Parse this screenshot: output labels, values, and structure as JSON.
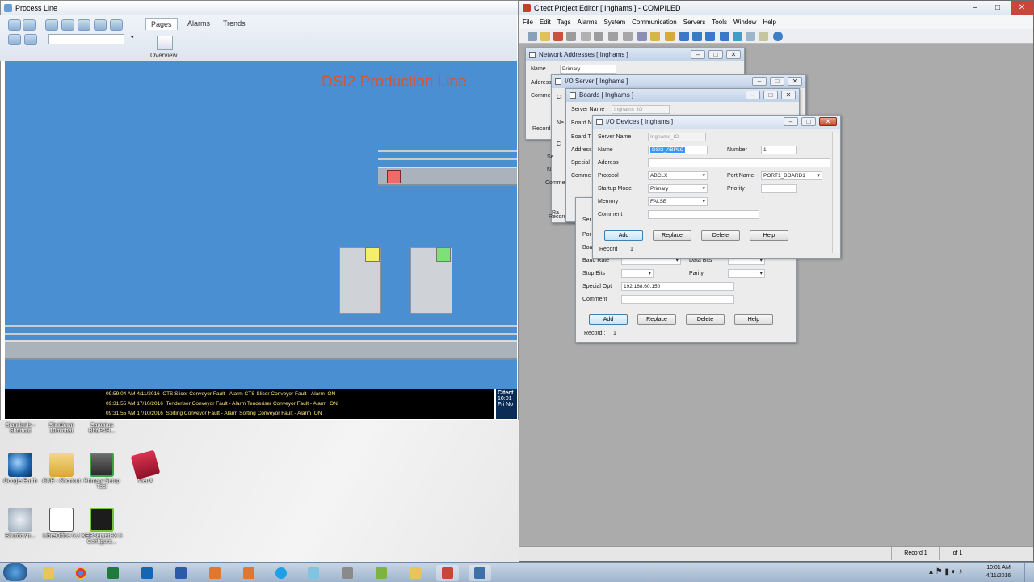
{
  "process_window": {
    "title": "Process Line",
    "tabs": [
      "Pages",
      "Alarms",
      "Trends"
    ],
    "overview_label": "Overview",
    "canvas_title": "DSI2 Production Line",
    "alarms": [
      {
        "time": "09:59:04 AM",
        "date": "4/11/2016",
        "desc": "CTS Slicer Conveyor Fault - Alarm",
        "desc2": "CTS Slicer Conveyor Fault - Alarm",
        "state": "ON"
      },
      {
        "time": "09:31:55 AM",
        "date": "17/10/2016",
        "desc": "Tenderiser Conveyor Fault - Alarm",
        "desc2": "Tenderiser Conveyor Fault - Alarm",
        "state": "ON"
      },
      {
        "time": "09:31:55 AM",
        "date": "17/10/2016",
        "desc": "Sorting Conveyor Fault - Alarm",
        "desc2": "Sorting Conveyor Fault - Alarm",
        "state": "ON"
      }
    ],
    "clock_lines": [
      "Citect",
      "10:01",
      "Fri No"
    ]
  },
  "desktop_icons": [
    {
      "label": "Standards - Shortcut"
    },
    {
      "label": "Shutdown 10minbat"
    },
    {
      "label": "Sartorius BhoPAH..."
    },
    {
      "label": "Google Earth"
    },
    {
      "label": "GKE - Shortcut"
    },
    {
      "label": "Primary Setup Tool"
    },
    {
      "label": "VieuX"
    },
    {
      "label": "Shutdown..."
    },
    {
      "label": "LibreOffice 5.2"
    },
    {
      "label": "KEPServerEX 5 Configura..."
    }
  ],
  "editor": {
    "title": "Citect Project Editor [ Inghams ] - COMPILED",
    "menu": [
      "File",
      "Edit",
      "Tags",
      "Alarms",
      "System",
      "Communication",
      "Servers",
      "Tools",
      "Window",
      "Help"
    ],
    "status_record": "Record 1",
    "status_of": "of 1"
  },
  "dialogs": {
    "network": {
      "title": "Network Addresses [ Inghams ]",
      "name_label": "Name",
      "name_value": "Primary",
      "address_label": "Address",
      "comment_label": "Comment",
      "record_label": "Record"
    },
    "ioserver": {
      "title": "I/O Server [ Inghams ]",
      "cl": "Cl",
      "ne": "Ne",
      "c": "C",
      "se": "Se",
      "n": "N",
      "commen": "Commen",
      "record": "Record"
    },
    "boards": {
      "title": "Boards [ Inghams ]",
      "server_name_label": "Server Name",
      "server_name_value": "Inghams_IO",
      "board_n": "Board N",
      "board_t": "Board T",
      "address": "Address",
      "special": "Special",
      "comment": "Comme",
      "ra": "Ra",
      "record": "Record"
    },
    "ports": {
      "ser": "Ser",
      "por": "Por",
      "boa": "Boa",
      "baud_label": "Baud Rate",
      "data_bits_label": "Data Bits",
      "stop_bits_label": "Stop Bits",
      "parity_label": "Parity",
      "special_opt_label": "Special Opt",
      "special_opt_value": "192.168.60.150",
      "comment_label": "Comment",
      "add": "Add",
      "replace": "Replace",
      "delete": "Delete",
      "help": "Help",
      "record_label": "Record :",
      "record_value": "1"
    },
    "iodevices": {
      "title": "I/O Devices [ Inghams ]",
      "server_name_label": "Server Name",
      "server_name_value": "Inghams_IO",
      "name_label": "Name",
      "name_value": "DSI2_ABPLC",
      "number_label": "Number",
      "number_value": "1",
      "address_label": "Address",
      "protocol_label": "Protocol",
      "protocol_value": "ABCLX",
      "port_name_label": "Port Name",
      "port_name_value": "PORT1_BOARD1",
      "startup_label": "Startup Mode",
      "startup_value": "Primary",
      "priority_label": "Priority",
      "memory_label": "Memory",
      "memory_value": "FALSE",
      "comment_label": "Comment",
      "add": "Add",
      "replace": "Replace",
      "delete": "Delete",
      "help": "Help",
      "record_label": "Record :",
      "record_value": "1"
    }
  },
  "tray": {
    "time": "10:01 AM",
    "date": "4/11/2016"
  },
  "colors": {
    "canvas": "#4a8fd1",
    "alarm_text": "#ffe57a",
    "indicator_red": "#f06a6a",
    "indicator_yellow": "#f4ef6a",
    "indicator_green": "#7ee07a"
  }
}
